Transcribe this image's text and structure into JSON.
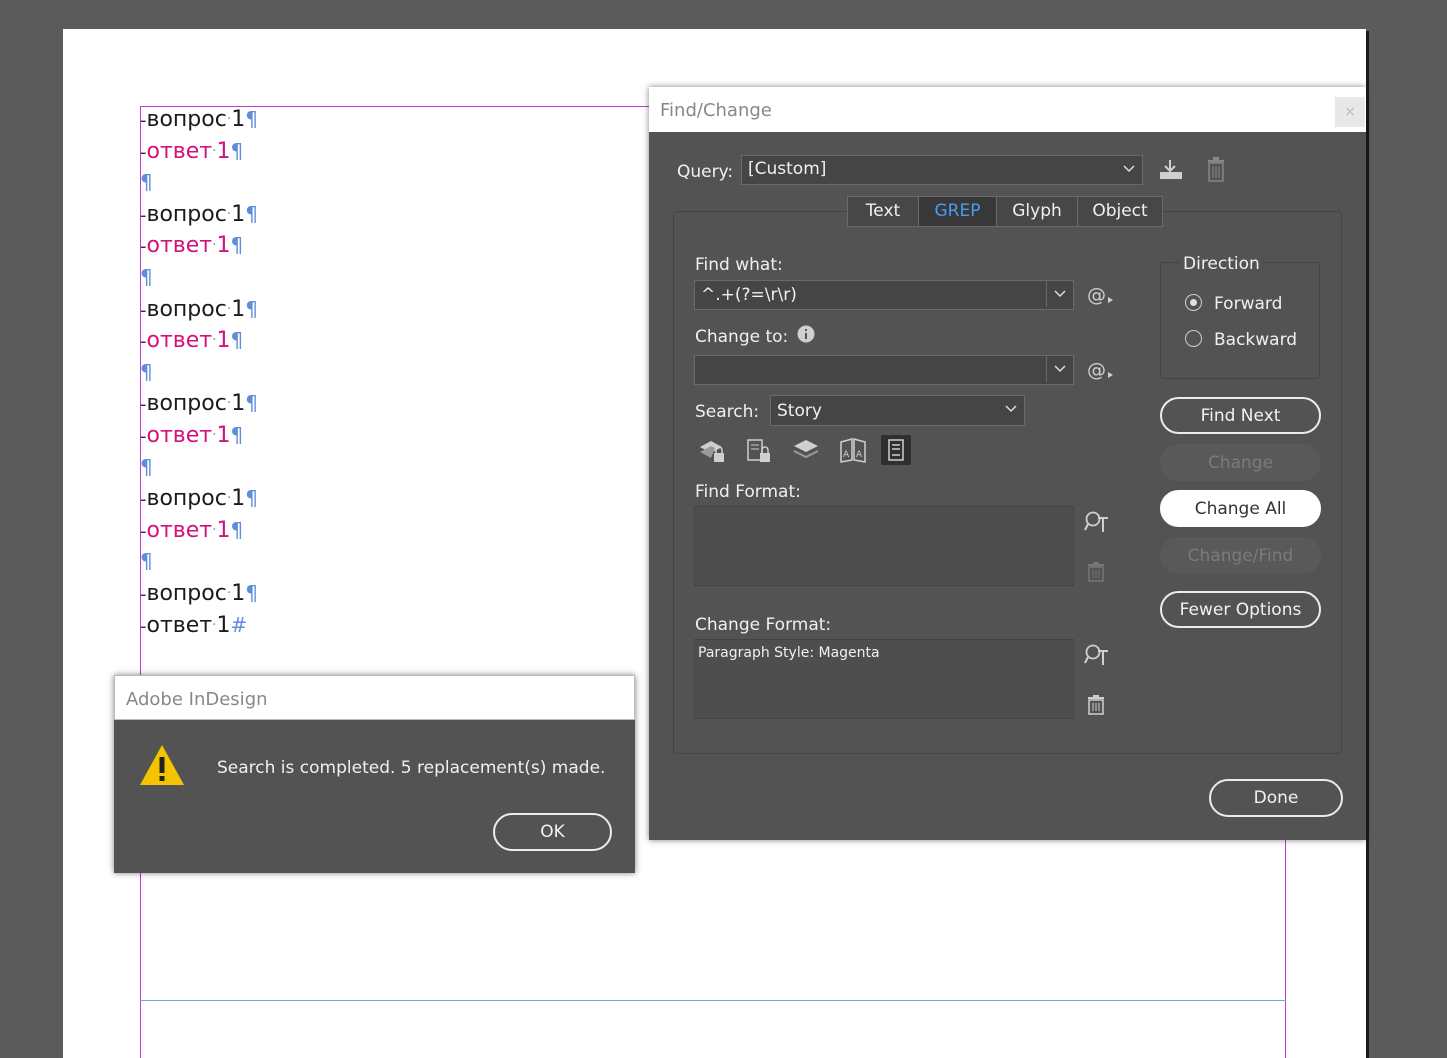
{
  "document": {
    "lines": [
      {
        "kind": "q",
        "word": "вопрос",
        "num": "1",
        "end": "¶"
      },
      {
        "kind": "a",
        "word": "ответ",
        "num": "1",
        "end": "¶"
      },
      {
        "kind": "blank",
        "end": "¶"
      },
      {
        "kind": "q",
        "word": "вопрос",
        "num": "1",
        "end": "¶"
      },
      {
        "kind": "a",
        "word": "ответ",
        "num": "1",
        "end": "¶"
      },
      {
        "kind": "blank",
        "end": "¶"
      },
      {
        "kind": "q",
        "word": "вопрос",
        "num": "1",
        "end": "¶"
      },
      {
        "kind": "a",
        "word": "ответ",
        "num": "1",
        "end": "¶"
      },
      {
        "kind": "blank",
        "end": "¶"
      },
      {
        "kind": "q",
        "word": "вопрос",
        "num": "1",
        "end": "¶"
      },
      {
        "kind": "a",
        "word": "ответ",
        "num": "1",
        "end": "¶"
      },
      {
        "kind": "blank",
        "end": "¶"
      },
      {
        "kind": "q",
        "word": "вопрос",
        "num": "1",
        "end": "¶"
      },
      {
        "kind": "a",
        "word": "ответ",
        "num": "1",
        "end": "¶"
      },
      {
        "kind": "blank",
        "end": "¶"
      },
      {
        "kind": "q",
        "word": "вопрос",
        "num": "1",
        "end": "¶"
      },
      {
        "kind": "last",
        "word": "ответ",
        "num": "1",
        "end": "#"
      }
    ],
    "colors": {
      "question": "#1b1b1b",
      "answer": "#d2127a",
      "pilcrow": "#5e8ed9"
    }
  },
  "find_change": {
    "title": "Find/Change",
    "close": "×",
    "query_label": "Query:",
    "query_value": "[Custom]",
    "tabs": [
      "Text",
      "GREP",
      "Glyph",
      "Object"
    ],
    "active_tab": "GREP",
    "find_what_label": "Find what:",
    "find_what_value": "^.+(?=\\r\\r)",
    "change_to_label": "Change to:",
    "change_to_value": "",
    "search_label": "Search:",
    "search_value": "Story",
    "find_format_label": "Find Format:",
    "find_format_value": "",
    "change_format_label": "Change Format:",
    "change_format_value": "Paragraph Style: Magenta",
    "direction": {
      "title": "Direction",
      "forward": "Forward",
      "backward": "Backward",
      "selected": "Forward"
    },
    "buttons": {
      "find_next": "Find Next",
      "change": "Change",
      "change_all": "Change All",
      "change_find": "Change/Find",
      "fewer_options": "Fewer Options",
      "done": "Done"
    },
    "search_options_icons": [
      "include-locked-layers-icon",
      "include-locked-stories-icon",
      "include-hidden-layers-icon",
      "include-master-pages-icon",
      "include-footnotes-icon"
    ],
    "accent_color": "#4a9cf0"
  },
  "alert": {
    "title": "Adobe InDesign",
    "message": "Search is completed.  5 replacement(s) made.",
    "ok": "OK",
    "icon": "warning-icon",
    "icon_color": "#f5c400"
  }
}
